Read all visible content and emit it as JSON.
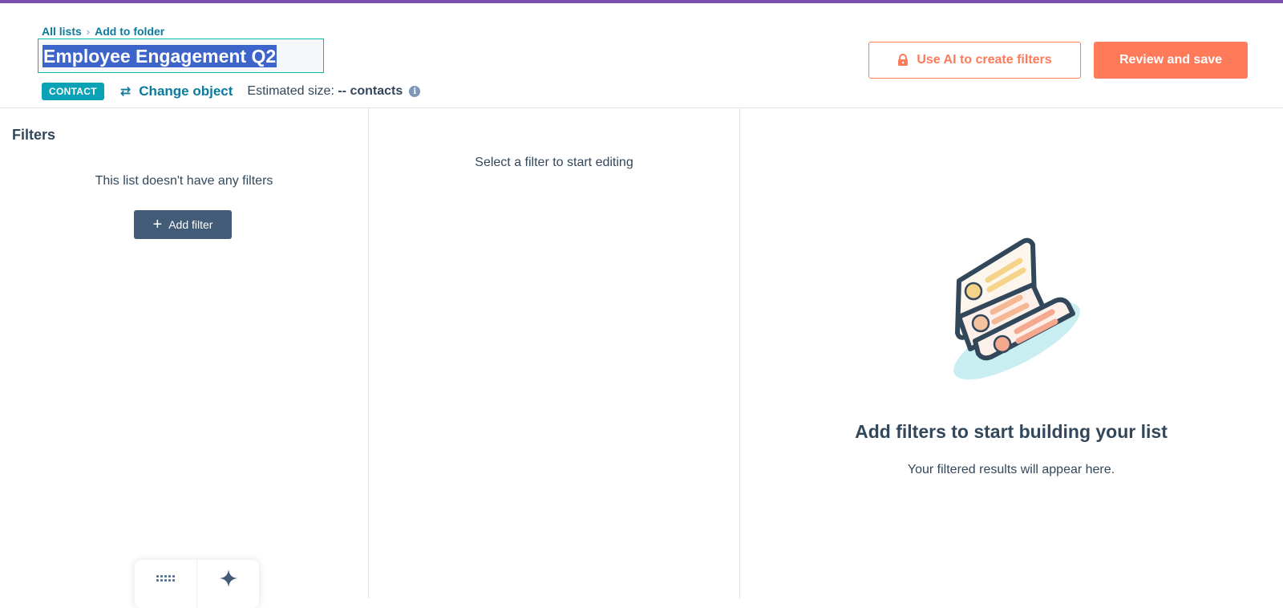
{
  "breadcrumb": {
    "all_lists": "All lists",
    "separator": "›",
    "add_to_folder": "Add to folder"
  },
  "list": {
    "title": "Employee Engagement Q2",
    "object_badge": "CONTACT",
    "change_object": "Change object",
    "estimated_label": "Estimated size:",
    "estimated_value": "-- contacts"
  },
  "actions": {
    "ai_filters": "Use AI to create filters",
    "review_save": "Review and save"
  },
  "filters_panel": {
    "title": "Filters",
    "empty_text": "This list doesn't have any filters",
    "add_filter": "Add filter"
  },
  "editor_panel": {
    "hint": "Select a filter to start editing"
  },
  "results_panel": {
    "title": "Add filters to start building your list",
    "subtitle": "Your filtered results will appear here."
  },
  "icons": {
    "lock": "lock-icon",
    "swap": "swap-arrows-icon",
    "info": "info-icon",
    "plus": "plus-icon",
    "apps": "apps-grid-icon",
    "sparkle": "sparkle-icon"
  },
  "colors": {
    "accent_top": "#7a4fb0",
    "link": "#0b7a9c",
    "primary": "#ff7a59",
    "badge": "#0ba2b7",
    "dark_button": "#425b76",
    "selection": "#3d64c9"
  }
}
